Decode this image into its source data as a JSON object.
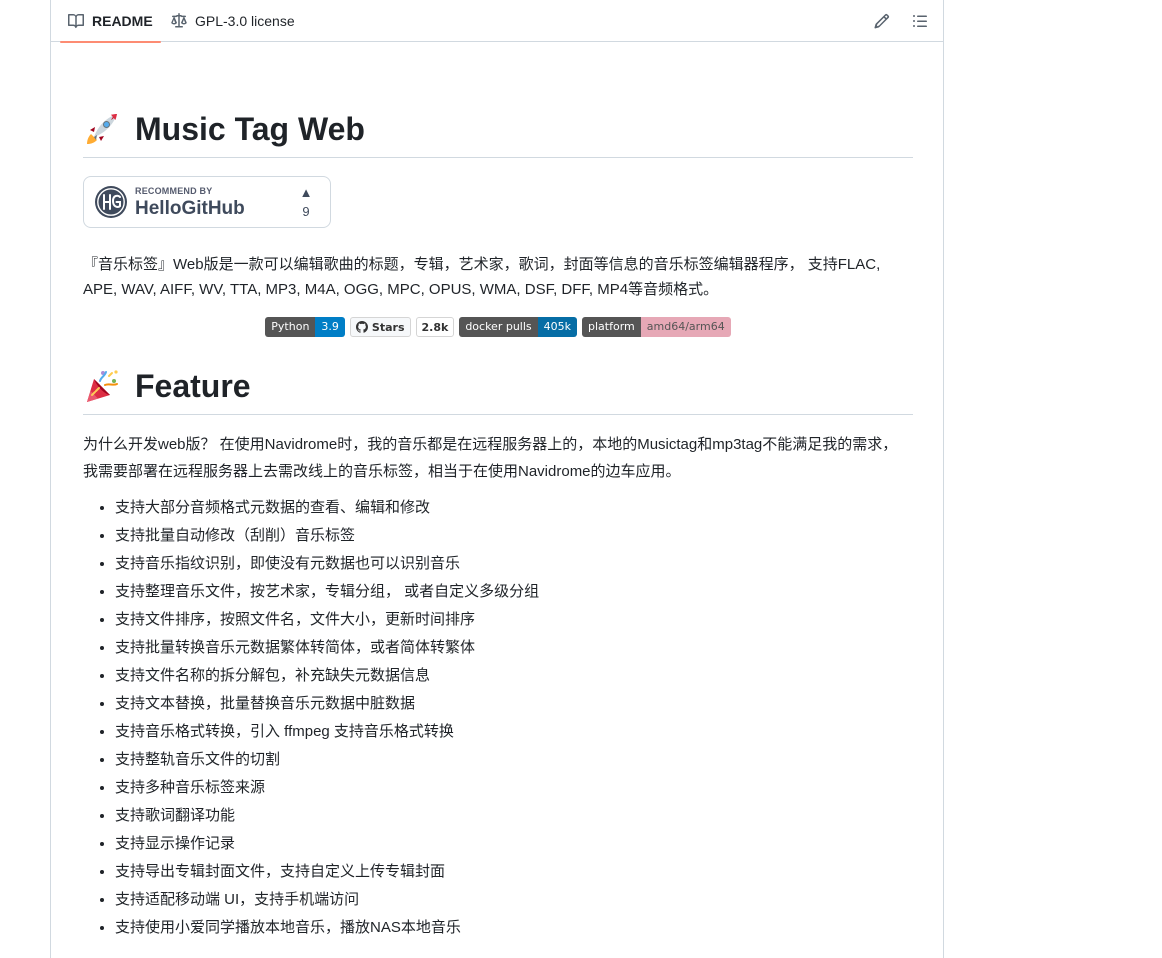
{
  "tabs": {
    "readme": "README",
    "license": "GPL-3.0 license"
  },
  "readme": {
    "title": "Music Tag Web",
    "recommend": {
      "small": "RECOMMEND BY",
      "name": "HelloGitHub",
      "arrow": "▲",
      "votes": "9"
    },
    "description": "『音乐标签』Web版是一款可以编辑歌曲的标题，专辑，艺术家，歌词，封面等信息的音乐标签编辑器程序， 支持FLAC, APE, WAV, AIFF, WV, TTA, MP3, M4A, OGG, MPC, OPUS, WMA, DSF, DFF, MP4等音频格式。",
    "badges": {
      "python": {
        "label": "Python",
        "value": "3.9",
        "color": "#007ec6"
      },
      "stars": {
        "label": "Stars",
        "value": "2.8k"
      },
      "docker": {
        "label": "docker pulls",
        "value": "405k",
        "color": "#066da5"
      },
      "platform": {
        "label": "platform",
        "value": "amd64/arm64",
        "color": "#e6a8b6"
      }
    },
    "feature_title": "Feature",
    "intro": "为什么开发web版？ 在使用Navidrome时，我的音乐都是在远程服务器上的，本地的Musictag和mp3tag不能满足我的需求， 我需要部署在远程服务器上去需改线上的音乐标签，相当于在使用Navidrome的边车应用。",
    "features": [
      "支持大部分音频格式元数据的查看、编辑和修改",
      "支持批量自动修改（刮削）音乐标签",
      "支持音乐指纹识别，即使没有元数据也可以识别音乐",
      "支持整理音乐文件，按艺术家，专辑分组， 或者自定义多级分组",
      "支持文件排序，按照文件名，文件大小，更新时间排序",
      "支持批量转换音乐元数据繁体转简体，或者简体转繁体",
      "支持文件名称的拆分解包，补充缺失元数据信息",
      "支持文本替换，批量替换音乐元数据中脏数据",
      "支持音乐格式转换，引入 ffmpeg 支持音乐格式转换",
      "支持整轨音乐文件的切割",
      "支持多种音乐标签来源",
      "支持歌词翻译功能",
      "支持显示操作记录",
      "支持导出专辑封面文件，支持自定义上传专辑封面",
      "支持适配移动端 UI，支持手机端访问",
      "支持使用小爱同学播放本地音乐，播放NAS本地音乐"
    ]
  }
}
